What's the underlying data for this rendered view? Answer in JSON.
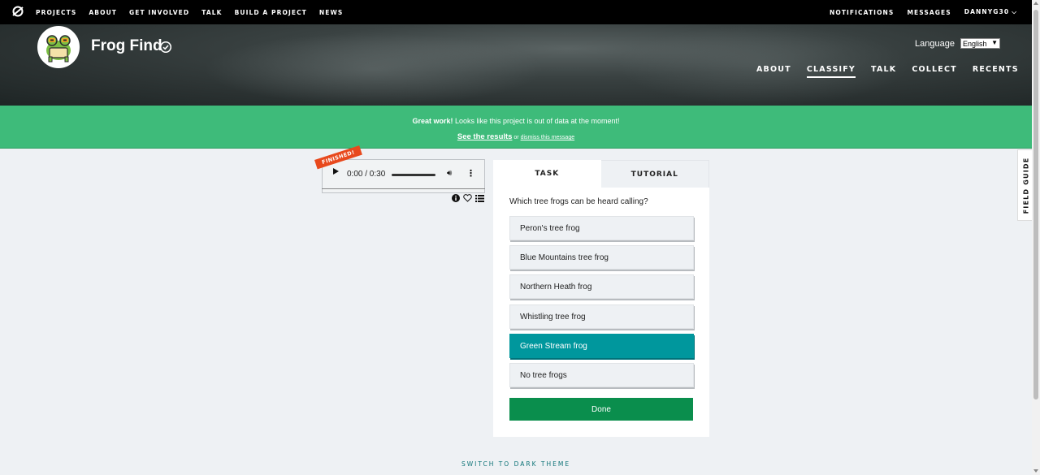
{
  "topnav": {
    "logo_icon": "zooniverse-logo-icon",
    "links": [
      "PROJECTS",
      "ABOUT",
      "GET INVOLVED",
      "TALK",
      "BUILD A PROJECT",
      "NEWS"
    ],
    "right": {
      "notifications": "NOTIFICATIONS",
      "messages": "MESSAGES",
      "user": "DANNYG30"
    }
  },
  "project": {
    "title": "Frog Find",
    "language_label": "Language",
    "language_value": "English",
    "nav": [
      "ABOUT",
      "CLASSIFY",
      "TALK",
      "COLLECT",
      "RECENTS"
    ],
    "active_nav": "CLASSIFY"
  },
  "banner": {
    "strong": "Great work!",
    "message": " Looks like this project is out of data at the moment!",
    "see_results": "See the results",
    "or": " or ",
    "dismiss": "dismiss this message",
    "color": "#3ebb7a"
  },
  "subject": {
    "badge": "FINISHED!",
    "time": "0:00 / 0:30",
    "icons": [
      "info-icon",
      "heart-icon",
      "list-icon"
    ]
  },
  "task": {
    "tabs": [
      "TASK",
      "TUTORIAL"
    ],
    "question": "Which tree frogs can be heard calling?",
    "answers": [
      "Peron's tree frog",
      "Blue Mountains tree frog",
      "Northern Heath frog",
      "Whistling tree frog",
      "Green Stream frog",
      "No tree frogs"
    ],
    "selected_answer": "Green Stream frog",
    "done": "Done",
    "accent": "#00979d",
    "done_color": "#0a8e4d"
  },
  "field_guide": "FIELD GUIDE",
  "theme_toggle": "SWITCH TO DARK THEME"
}
